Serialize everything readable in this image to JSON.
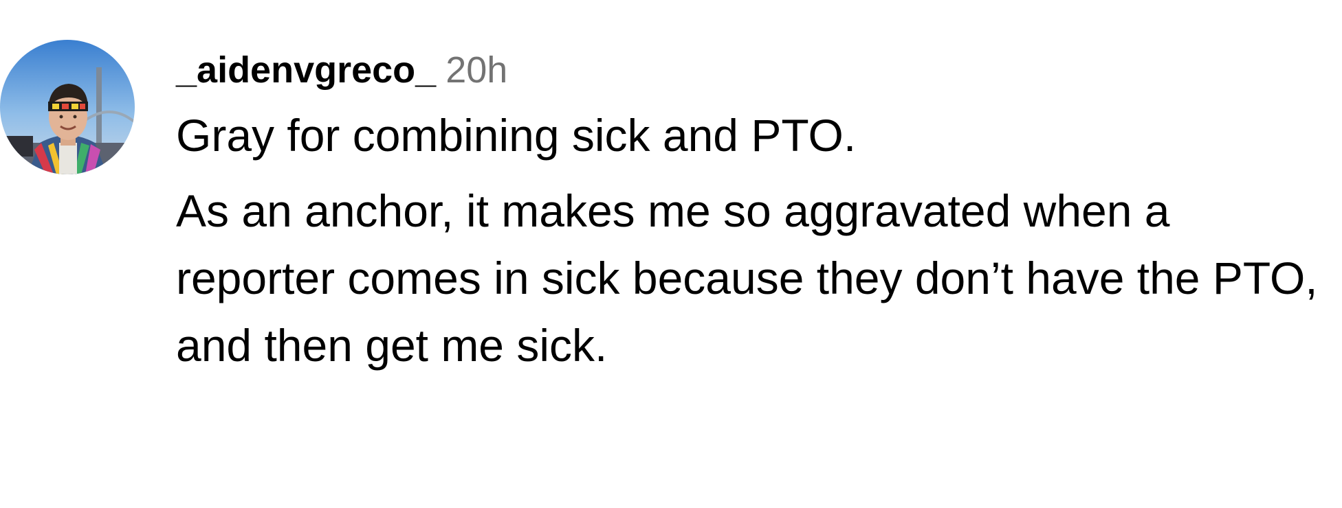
{
  "comment": {
    "avatar_icon": "profile-avatar-photo",
    "username": "_aidenvgreco_",
    "timestamp": "20h",
    "paragraphs": [
      "Gray for combining sick and PTO.",
      "As an anchor, it makes me so aggravated when a reporter comes in sick because they don’t have the PTO, and then get me sick."
    ]
  },
  "colors": {
    "text": "#000000",
    "timestamp": "#737373",
    "background": "#ffffff"
  }
}
